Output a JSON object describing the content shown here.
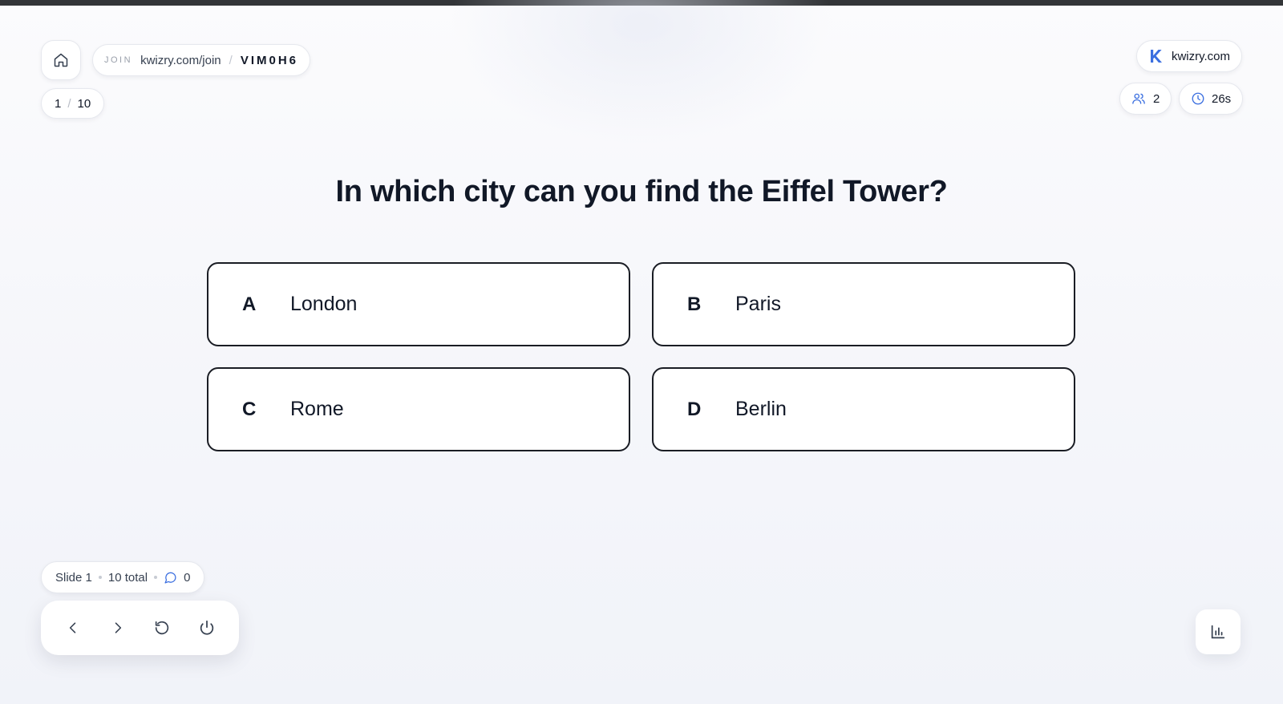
{
  "header": {
    "join_label": "JOIN",
    "join_url": "kwizry.com/join",
    "join_separator": "/",
    "join_code": "VIM0H6",
    "slide_current": "1",
    "slide_separator": "/",
    "slide_total": "10",
    "brand": "kwizry.com",
    "players_count": "2",
    "timer": "26s"
  },
  "question": {
    "text": "In which city can you find the Eiffel Tower?"
  },
  "answers": [
    {
      "letter": "A",
      "text": "London"
    },
    {
      "letter": "B",
      "text": "Paris"
    },
    {
      "letter": "C",
      "text": "Rome"
    },
    {
      "letter": "D",
      "text": "Berlin"
    }
  ],
  "footer": {
    "slide_label": "Slide 1",
    "total_label": "10 total",
    "comments_count": "0"
  },
  "icons": {
    "home": "home-icon",
    "brand_logo": "kwizry-logo-icon",
    "players": "users-icon",
    "timer": "clock-icon",
    "comments": "comment-icon",
    "prev": "chevron-left-icon",
    "next": "chevron-right-icon",
    "restart": "restart-icon",
    "power": "power-icon",
    "stats": "bar-chart-icon"
  },
  "colors": {
    "accent": "#3b6fe0",
    "text": "#111827",
    "answer_border": "#1a1d24",
    "top_bar": "#333538"
  }
}
